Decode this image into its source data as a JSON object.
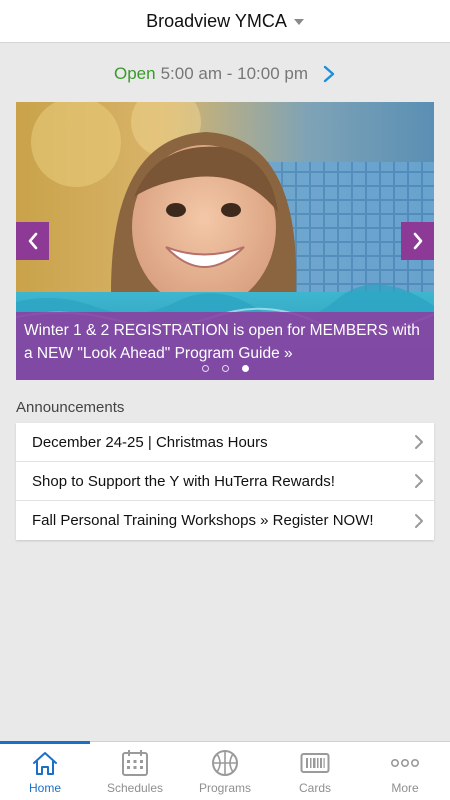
{
  "header": {
    "title": "Broadview YMCA"
  },
  "hours": {
    "status": "Open",
    "range": "5:00 am - 10:00 pm"
  },
  "carousel": {
    "caption": "Winter 1 & 2 REGISTRATION is open for MEMBERS with a NEW \"Look Ahead\" Program Guide »",
    "slide_count": 3,
    "active_slide": 3
  },
  "announcements": {
    "heading": "Announcements",
    "items": [
      {
        "label": "December 24-25 | Christmas Hours"
      },
      {
        "label": "Shop to Support the Y with HuTerra Rewards!"
      },
      {
        "label": "Fall Personal Training Workshops » Register NOW!"
      }
    ]
  },
  "tabs": [
    {
      "label": "Home",
      "icon": "home-icon",
      "active": true
    },
    {
      "label": "Schedules",
      "icon": "calendar-icon",
      "active": false
    },
    {
      "label": "Programs",
      "icon": "basketball-icon",
      "active": false
    },
    {
      "label": "Cards",
      "icon": "barcode-card-icon",
      "active": false
    },
    {
      "label": "More",
      "icon": "more-dots-icon",
      "active": false
    }
  ],
  "colors": {
    "open_green": "#3a9a2a",
    "accent_blue": "#1a6fc9",
    "carousel_purple": "#8c3a96"
  }
}
